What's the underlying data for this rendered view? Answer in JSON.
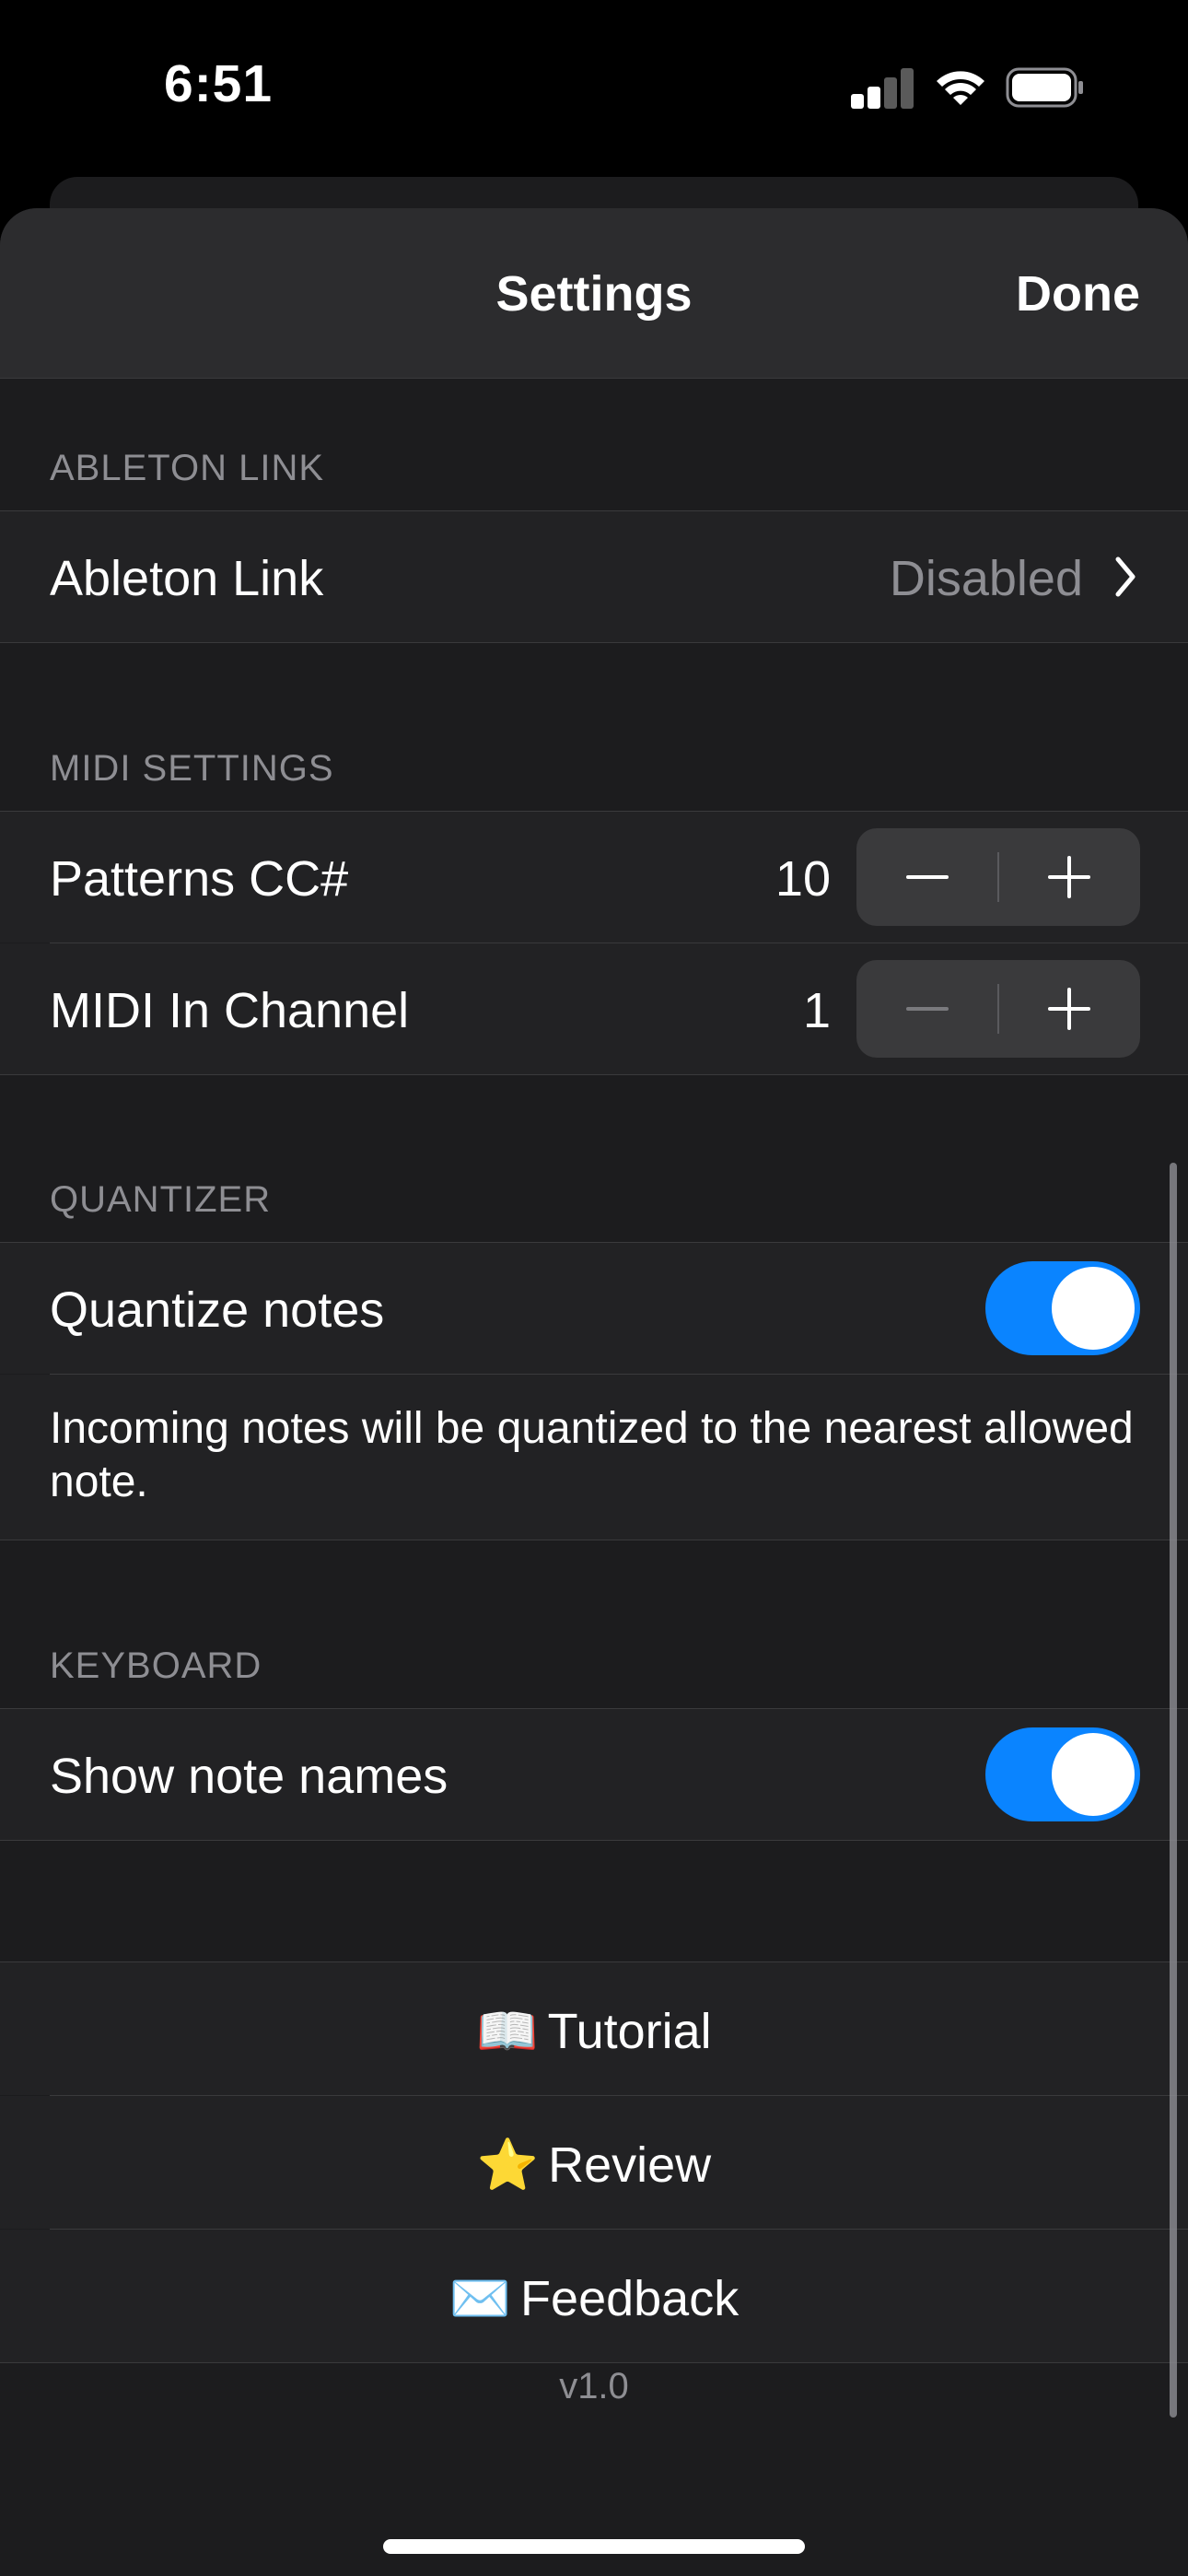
{
  "status_bar": {
    "time": "6:51"
  },
  "nav": {
    "title": "Settings",
    "done_label": "Done"
  },
  "sections": {
    "ableton": {
      "header": "ABLETON LINK",
      "row_label": "Ableton Link",
      "row_value": "Disabled"
    },
    "midi": {
      "header": "MIDI SETTINGS",
      "patterns_label": "Patterns CC#",
      "patterns_value": "10",
      "channel_label": "MIDI In Channel",
      "channel_value": "1"
    },
    "quantizer": {
      "header": "QUANTIZER",
      "quantize_label": "Quantize notes",
      "quantize_on": true,
      "footer": "Incoming notes will be quantized to the nearest allowed note."
    },
    "keyboard": {
      "header": "KEYBOARD",
      "note_names_label": "Show note names",
      "note_names_on": true
    }
  },
  "actions": [
    {
      "icon": "📖",
      "label": "Tutorial"
    },
    {
      "icon": "⭐",
      "label": "Review"
    },
    {
      "icon": "✉️",
      "label": "Feedback"
    }
  ],
  "version": "v1.0",
  "colors": {
    "accent": "#0a84ff",
    "background": "#1c1c1e",
    "secondary_text": "#8e8e93"
  }
}
